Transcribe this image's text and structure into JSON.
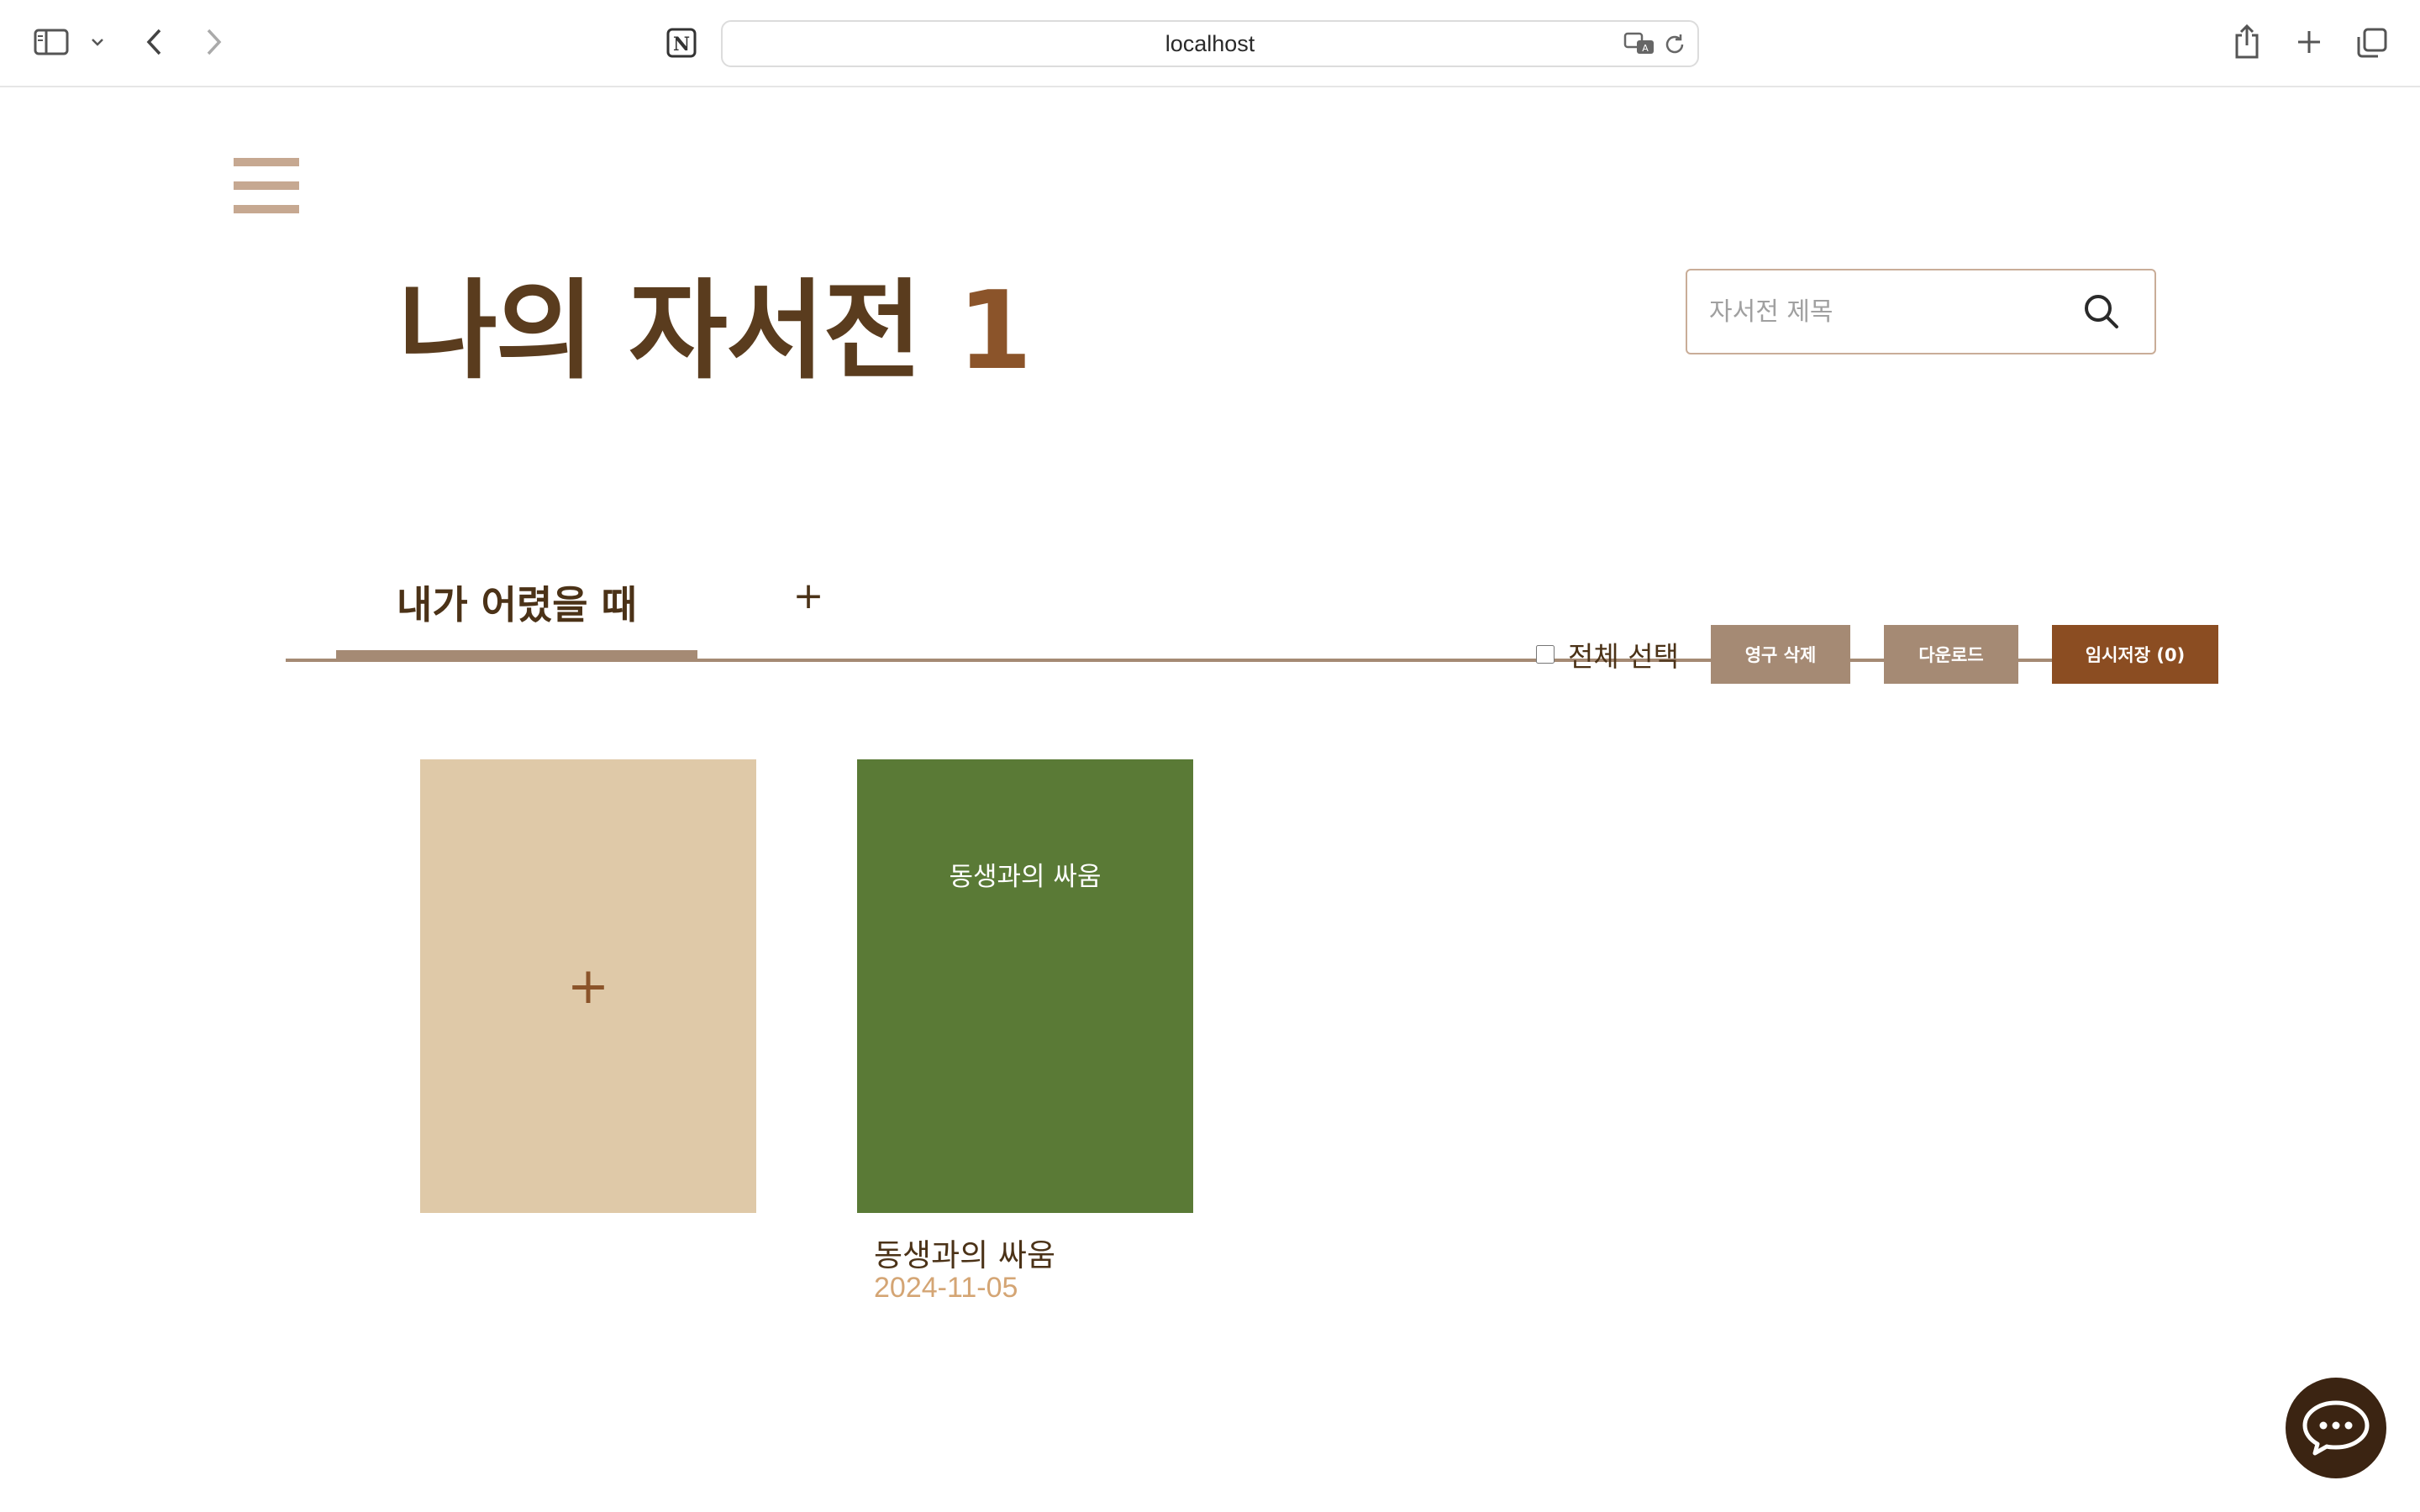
{
  "browser": {
    "url": "localhost",
    "icons": [
      "sidebar-icon",
      "chevron-down-icon",
      "back-icon",
      "forward-icon",
      "notion-icon",
      "translate-icon",
      "reload-icon",
      "share-icon",
      "new-tab-icon",
      "tabs-overview-icon"
    ]
  },
  "header": {
    "title": "나의 자서전",
    "count": "1",
    "search_placeholder": "자서전 제목"
  },
  "tabs": [
    {
      "label": "내가 어렸을 때",
      "active": true
    }
  ],
  "tab_add_label": "+",
  "toolbar": {
    "select_all_label": "전체 선택",
    "delete_label": "영구 삭제",
    "download_label": "다운로드",
    "draft_label": "임시저장 (0)"
  },
  "cards": {
    "add_label": "+",
    "books": [
      {
        "cover_title": "동생과의 싸움",
        "name": "동생과의 싸움",
        "date": "2024-11-05",
        "cover_color": "#5a7a36"
      }
    ]
  },
  "colors": {
    "primary_brown": "#5a3c1e",
    "accent_brown": "#8b4d22",
    "muted_brown": "#a58a74",
    "add_card": "#dfc9a8",
    "date": "#d4a574"
  }
}
